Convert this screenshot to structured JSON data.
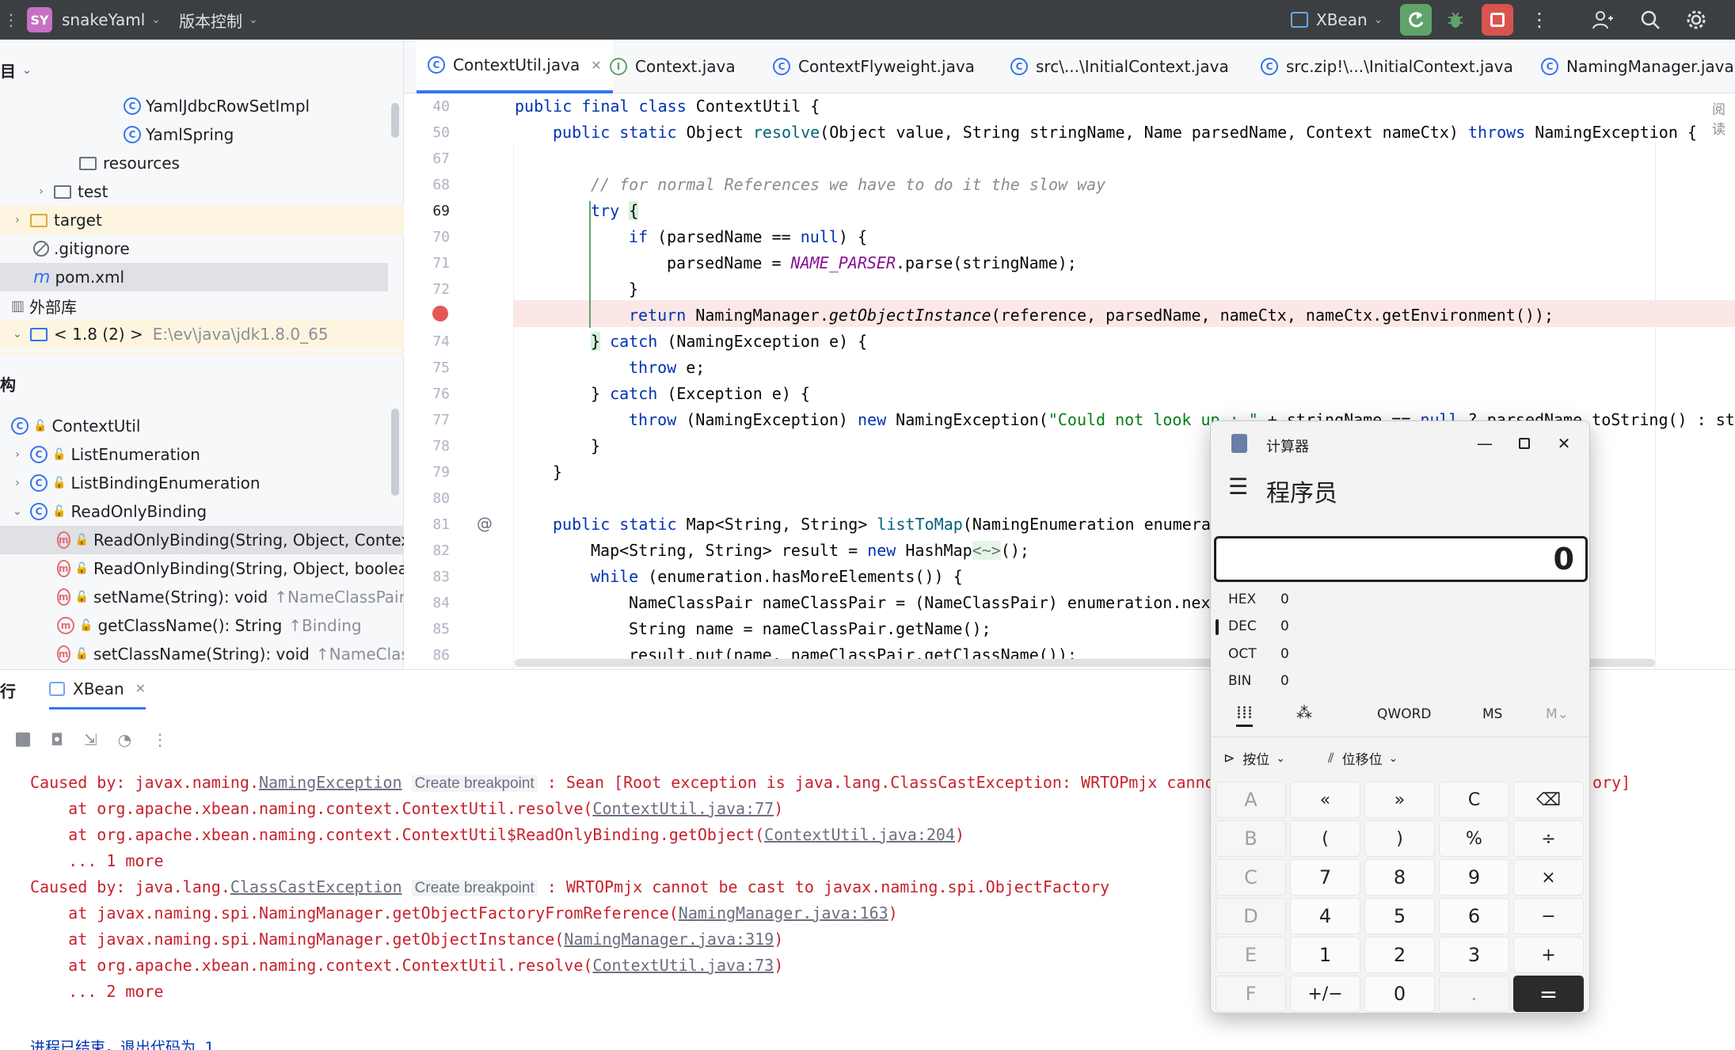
{
  "titlebar": {
    "project_badge": "SY",
    "project_name": "snakeYaml",
    "vcs_label": "版本控制",
    "run_config": "XBean"
  },
  "project_panel": {
    "header": "目",
    "items": [
      {
        "label": "YamlJdbcRowSetImpl"
      },
      {
        "label": "YamlSpring"
      },
      {
        "label": "resources"
      },
      {
        "label": "test"
      },
      {
        "label": "target"
      },
      {
        "label": ".gitignore"
      },
      {
        "label": "pom.xml"
      },
      {
        "label": "外部库"
      },
      {
        "label": "< 1.8 (2) >",
        "hint": "E:\\ev\\java\\jdk1.8.0_65"
      }
    ],
    "structure_header": "构",
    "structure_items": [
      {
        "label": "ContextUtil"
      },
      {
        "label": "ListEnumeration"
      },
      {
        "label": "ListBindingEnumeration"
      },
      {
        "label": "ReadOnlyBinding"
      },
      {
        "label": "ReadOnlyBinding(String, Object, Context)"
      },
      {
        "label": "ReadOnlyBinding(String, Object, boolean,"
      },
      {
        "label": "setName(String): void",
        "hint": "↑NameClassPair"
      },
      {
        "label": "getClassName(): String",
        "hint": "↑Binding"
      },
      {
        "label": "setClassName(String): void",
        "hint": "↑NameClassPa"
      }
    ]
  },
  "tabs": [
    {
      "label": "ContextUtil.java"
    },
    {
      "label": "Context.java"
    },
    {
      "label": "ContextFlyweight.java"
    },
    {
      "label": "src\\...\\InitialContext.java"
    },
    {
      "label": "src.zip!\\...\\InitialContext.java"
    },
    {
      "label": "NamingManager.java"
    }
  ],
  "editor": {
    "reader_mode": "阅读",
    "line_numbers": [
      "40",
      "50",
      "67",
      "68",
      "69",
      "70",
      "71",
      "72",
      "",
      "74",
      "75",
      "76",
      "77",
      "78",
      "79",
      "80",
      "81",
      "82",
      "83",
      "84",
      "85",
      "86"
    ]
  },
  "run_panel": {
    "title": "行",
    "tab_label": "XBean",
    "console": {
      "l1_a": "Caused by: javax.naming.",
      "l1_link": "NamingException",
      "l1_bp": "Create breakpoint",
      "l1_b": " : Sean [Root exception is java.lang.ClassCastException: WRTOPmjx cannot",
      "l1_tail": "ory]",
      "l2_a": "    at org.apache.xbean.naming.context.ContextUtil.resolve(",
      "l2_link": "ContextUtil.java:77",
      "l3_a": "    at org.apache.xbean.naming.context.ContextUtil$ReadOnlyBinding.getObject(",
      "l3_link": "ContextUtil.java:204",
      "l4": "    ... 1 more",
      "l5_a": "Caused by: java.lang.",
      "l5_link": "ClassCastException",
      "l5_bp": "Create breakpoint",
      "l5_b": " : WRTOPmjx cannot be cast to javax.naming.spi.ObjectFactory",
      "l6_a": "    at javax.naming.spi.NamingManager.getObjectFactoryFromReference(",
      "l6_link": "NamingManager.java:163",
      "l7_a": "    at javax.naming.spi.NamingManager.getObjectInstance(",
      "l7_link": "NamingManager.java:319",
      "l8_a": "    at org.apache.xbean.naming.context.ContextUtil.resolve(",
      "l8_link": "ContextUtil.java:73",
      "l9": "    ... 2 more",
      "exit": "进程已结束，退出代码为 1"
    }
  },
  "calculator": {
    "title": "计算器",
    "mode": "程序员",
    "display": "0",
    "radix": [
      {
        "name": "HEX",
        "value": "0"
      },
      {
        "name": "DEC",
        "value": "0"
      },
      {
        "name": "OCT",
        "value": "0"
      },
      {
        "name": "BIN",
        "value": "0"
      }
    ],
    "word_size": "QWORD",
    "ms": "MS",
    "mplus": "M⌄",
    "bitwise": "按位",
    "bitshift": "位移位",
    "keys": [
      "A",
      "«",
      "»",
      "C",
      "⌫",
      "B",
      "(",
      ")",
      "%",
      "÷",
      "C",
      "7",
      "8",
      "9",
      "×",
      "D",
      "4",
      "5",
      "6",
      "−",
      "E",
      "1",
      "2",
      "3",
      "+",
      "F",
      "+/−",
      "0",
      ".",
      "="
    ]
  }
}
